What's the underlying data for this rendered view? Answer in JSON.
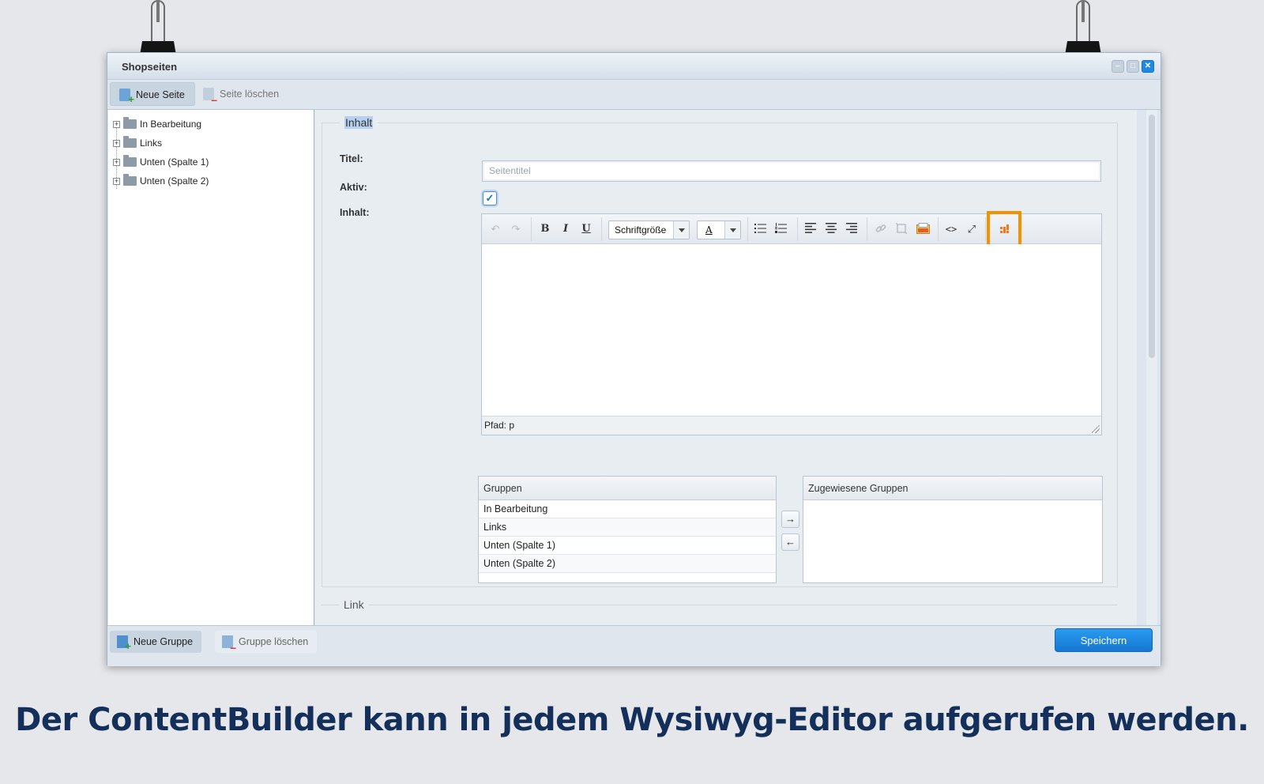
{
  "window": {
    "title": "Shopseiten",
    "controls": {
      "minimize": "–",
      "maximize": "□",
      "close": "✕"
    }
  },
  "toolbar": {
    "new_page": "Neue Seite",
    "delete_page": "Seite löschen"
  },
  "tree": {
    "items": [
      {
        "label": "In Bearbeitung",
        "expander": "+"
      },
      {
        "label": "Links",
        "expander": "+"
      },
      {
        "label": "Unten (Spalte 1)",
        "expander": "+"
      },
      {
        "label": "Unten (Spalte 2)",
        "expander": "+"
      }
    ]
  },
  "form": {
    "section_content": "Inhalt",
    "section_link": "Link",
    "title_label": "Titel:",
    "title_placeholder": "Seitentitel",
    "title_value": "",
    "active_label": "Aktiv:",
    "active_checked": true,
    "active_mark": "✓",
    "content_label": "Inhalt:"
  },
  "editor": {
    "toolbar": {
      "undo": "↶",
      "redo": "↷",
      "bold": "B",
      "italic": "I",
      "underline": "U",
      "font_size": "Schriftgröße",
      "text_color": "A",
      "code": "<>",
      "fullscreen": "⤢"
    },
    "status_path": "Pfad: p",
    "highlight_color": "#f39200"
  },
  "groups": {
    "available_header": "Gruppen",
    "available": [
      "In Bearbeitung",
      "Links",
      "Unten (Spalte 1)",
      "Unten (Spalte 2)"
    ],
    "assigned_header": "Zugewiesene Gruppen",
    "assigned": [],
    "move_right": "→",
    "move_left": "←"
  },
  "bottombar": {
    "new_group": "Neue Gruppe",
    "delete_group": "Gruppe löschen",
    "save": "Speichern"
  },
  "caption": "Der ContentBuilder kann in jedem Wysiwyg-Editor aufgerufen werden.",
  "colors": {
    "accent": "#1f8ae3",
    "caption": "#14305a",
    "background": "#e5e7ea"
  }
}
